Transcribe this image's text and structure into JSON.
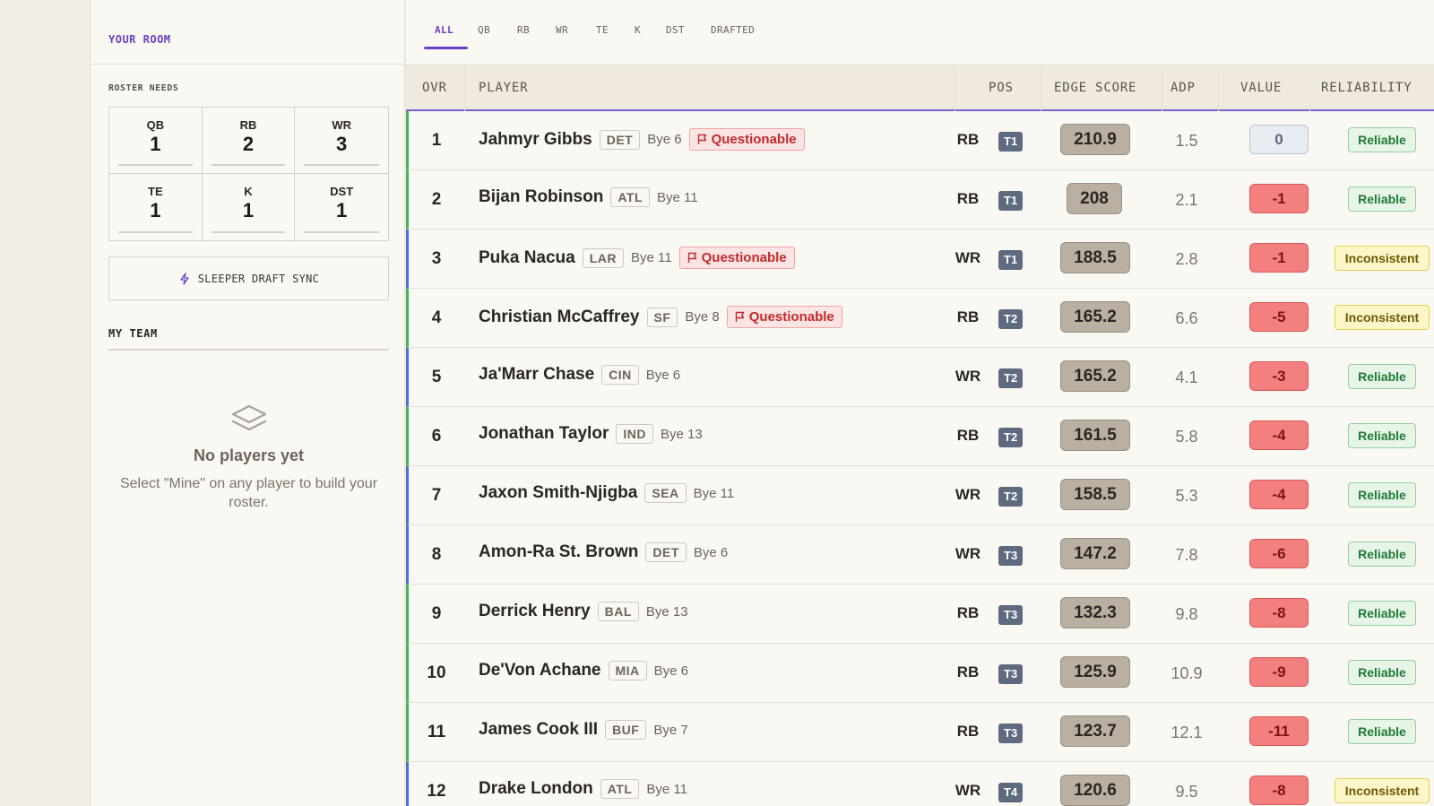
{
  "sidebar": {
    "room_title": "YOUR ROOM",
    "roster_needs_label": "ROSTER NEEDS",
    "roster_needs": [
      {
        "pos": "QB",
        "count": "1"
      },
      {
        "pos": "RB",
        "count": "2"
      },
      {
        "pos": "WR",
        "count": "3"
      },
      {
        "pos": "TE",
        "count": "1"
      },
      {
        "pos": "K",
        "count": "1"
      },
      {
        "pos": "DST",
        "count": "1"
      }
    ],
    "sync_button": {
      "label": "SLEEPER DRAFT SYNC",
      "icon": "bolt-icon"
    },
    "my_team_label": "MY TEAM",
    "empty_state": {
      "icon": "layers-icon",
      "title": "No players yet",
      "text": "Select \"Mine\" on any player to build your roster."
    }
  },
  "tabs": [
    "ALL",
    "QB",
    "RB",
    "WR",
    "TE",
    "K",
    "DST",
    "DRAFTED"
  ],
  "active_tab": "ALL",
  "table": {
    "headers": {
      "ovr": "OVR",
      "player": "PLAYER",
      "pos": "POS",
      "edge": "EDGE SCORE",
      "adp": "ADP",
      "value": "VALUE",
      "reliability": "RELIABILITY"
    },
    "rows": [
      {
        "ovr": "1",
        "name": "Jahmyr Gibbs",
        "team": "DET",
        "bye": "Bye 6",
        "flag": "Questionable",
        "pos": "RB",
        "tier": "T1",
        "edge": "210.9",
        "adp": "1.5",
        "value": "0",
        "reliability": "Reliable"
      },
      {
        "ovr": "2",
        "name": "Bijan Robinson",
        "team": "ATL",
        "bye": "Bye 11",
        "flag": "",
        "pos": "RB",
        "tier": "T1",
        "edge": "208",
        "adp": "2.1",
        "value": "-1",
        "reliability": "Reliable"
      },
      {
        "ovr": "3",
        "name": "Puka Nacua",
        "team": "LAR",
        "bye": "Bye 11",
        "flag": "Questionable",
        "pos": "WR",
        "tier": "T1",
        "edge": "188.5",
        "adp": "2.8",
        "value": "-1",
        "reliability": "Inconsistent"
      },
      {
        "ovr": "4",
        "name": "Christian McCaffrey",
        "team": "SF",
        "bye": "Bye 8",
        "flag": "Questionable",
        "pos": "RB",
        "tier": "T2",
        "edge": "165.2",
        "adp": "6.6",
        "value": "-5",
        "reliability": "Inconsistent"
      },
      {
        "ovr": "5",
        "name": "Ja'Marr Chase",
        "team": "CIN",
        "bye": "Bye 6",
        "flag": "",
        "pos": "WR",
        "tier": "T2",
        "edge": "165.2",
        "adp": "4.1",
        "value": "-3",
        "reliability": "Reliable"
      },
      {
        "ovr": "6",
        "name": "Jonathan Taylor",
        "team": "IND",
        "bye": "Bye 13",
        "flag": "",
        "pos": "RB",
        "tier": "T2",
        "edge": "161.5",
        "adp": "5.8",
        "value": "-4",
        "reliability": "Reliable"
      },
      {
        "ovr": "7",
        "name": "Jaxon Smith-Njigba",
        "team": "SEA",
        "bye": "Bye 11",
        "flag": "",
        "pos": "WR",
        "tier": "T2",
        "edge": "158.5",
        "adp": "5.3",
        "value": "-4",
        "reliability": "Reliable"
      },
      {
        "ovr": "8",
        "name": "Amon-Ra St. Brown",
        "team": "DET",
        "bye": "Bye 6",
        "flag": "",
        "pos": "WR",
        "tier": "T3",
        "edge": "147.2",
        "adp": "7.8",
        "value": "-6",
        "reliability": "Reliable"
      },
      {
        "ovr": "9",
        "name": "Derrick Henry",
        "team": "BAL",
        "bye": "Bye 13",
        "flag": "",
        "pos": "RB",
        "tier": "T3",
        "edge": "132.3",
        "adp": "9.8",
        "value": "-8",
        "reliability": "Reliable"
      },
      {
        "ovr": "10",
        "name": "De'Von Achane",
        "team": "MIA",
        "bye": "Bye 6",
        "flag": "",
        "pos": "RB",
        "tier": "T3",
        "edge": "125.9",
        "adp": "10.9",
        "value": "-9",
        "reliability": "Reliable"
      },
      {
        "ovr": "11",
        "name": "James Cook III",
        "team": "BUF",
        "bye": "Bye 7",
        "flag": "",
        "pos": "RB",
        "tier": "T3",
        "edge": "123.7",
        "adp": "12.1",
        "value": "-11",
        "reliability": "Reliable"
      },
      {
        "ovr": "12",
        "name": "Drake London",
        "team": "ATL",
        "bye": "Bye 11",
        "flag": "",
        "pos": "WR",
        "tier": "T4",
        "edge": "120.6",
        "adp": "9.5",
        "value": "-8",
        "reliability": "Inconsistent"
      }
    ]
  },
  "colors": {
    "accent": "#6b3fc4",
    "rb_stripe": "#3fb45a",
    "wr_stripe": "#4a6fd1",
    "value_negative": "#f47f7f"
  }
}
